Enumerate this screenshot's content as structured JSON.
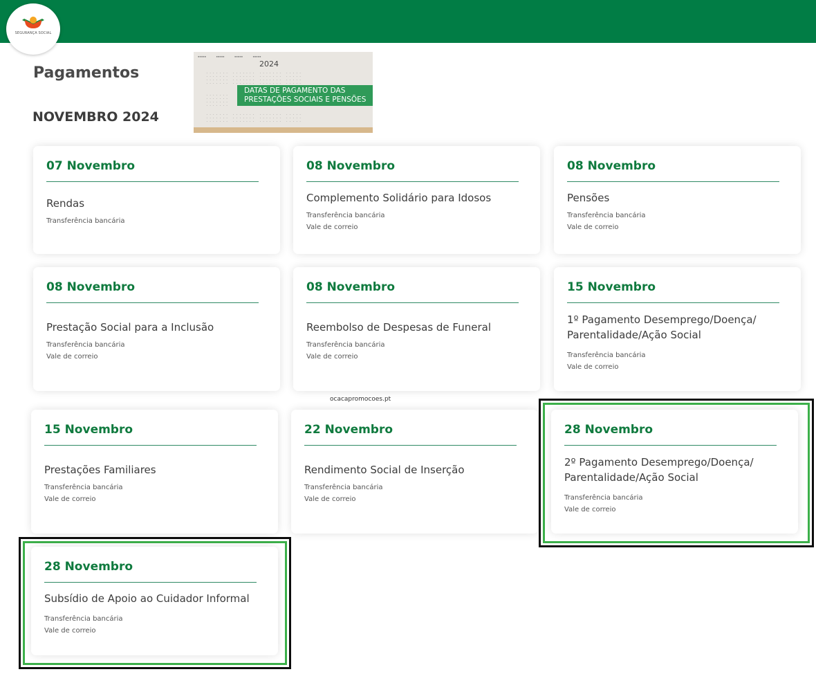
{
  "header": {
    "logo_text": "SEGURANÇA SOCIAL",
    "brand_color": "#017d45"
  },
  "page": {
    "title": "Pagamentos",
    "month": "NOVEMBRO 2024"
  },
  "banner": {
    "year": "2024",
    "line1": "DATAS DE PAGAMENTO DAS",
    "line2": "PRESTAÇÕES SOCIAIS E PENSÕES"
  },
  "watermark": "ocacapromocoes.pt",
  "cards": [
    {
      "date": "07 Novembro",
      "name": "Rendas",
      "methods": [
        "Transferência bancária"
      ]
    },
    {
      "date": "08 Novembro",
      "name": "Complemento Solidário para Idosos",
      "methods": [
        "Transferência bancária",
        "Vale de correio"
      ]
    },
    {
      "date": "08 Novembro",
      "name": "Pensões",
      "methods": [
        "Transferência bancária",
        "Vale de correio"
      ]
    },
    {
      "date": "08 Novembro",
      "name": "Prestação Social para a Inclusão",
      "methods": [
        "Transferência bancária",
        "Vale de correio"
      ]
    },
    {
      "date": "08 Novembro",
      "name": "Reembolso de Despesas de Funeral",
      "methods": [
        "Transferência bancária",
        "Vale de correio"
      ]
    },
    {
      "date": "15 Novembro",
      "name": "1º Pagamento Desemprego/Doença/ Parentalidade/Ação Social",
      "methods": [
        "Transferência bancária",
        "Vale de correio"
      ]
    },
    {
      "date": "15 Novembro",
      "name": "Prestações Familiares",
      "methods": [
        "Transferência bancária",
        "Vale de correio"
      ]
    },
    {
      "date": "22 Novembro",
      "name": "Rendimento Social de Inserção",
      "methods": [
        "Transferência bancária",
        "Vale de correio"
      ]
    },
    {
      "date": "28 Novembro",
      "name": "2º Pagamento Desemprego/Doença/ Parentalidade/Ação Social",
      "methods": [
        "Transferência bancária",
        "Vale de correio"
      ]
    },
    {
      "date": "28 Novembro",
      "name": "Subsídio de Apoio ao Cuidador Informal",
      "methods": [
        "Transferência bancária",
        "Vale de correio"
      ]
    }
  ]
}
